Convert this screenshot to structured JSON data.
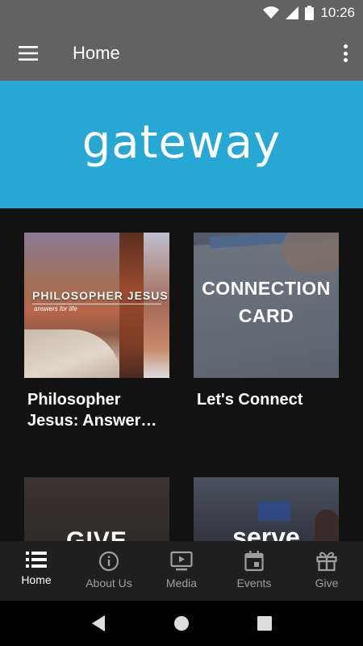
{
  "status_bar": {
    "time": "10:26"
  },
  "app_bar": {
    "title": "Home"
  },
  "banner": {
    "logo_text": "gateway",
    "background_color": "#27a7d3"
  },
  "cards": [
    {
      "title": "Philosopher Jesus: Answer…",
      "image_text": "PHILOSOPHER JESUS",
      "image_subtext": "answers for life"
    },
    {
      "title": "Let's Connect",
      "image_text_line1": "CONNECTION",
      "image_text_line2": "CARD"
    },
    {
      "title": "",
      "image_text": "GIVE"
    },
    {
      "title": "",
      "image_text": "serve"
    }
  ],
  "bottom_nav": {
    "items": [
      {
        "label": "Home",
        "icon": "list-icon",
        "active": true
      },
      {
        "label": "About Us",
        "icon": "info-icon",
        "active": false
      },
      {
        "label": "Media",
        "icon": "media-icon",
        "active": false
      },
      {
        "label": "Events",
        "icon": "calendar-icon",
        "active": false
      },
      {
        "label": "Give",
        "icon": "gift-icon",
        "active": false
      }
    ]
  },
  "system_nav": {
    "buttons": [
      "back",
      "home",
      "recents"
    ]
  },
  "colors": {
    "app_bar": "#626262",
    "background": "#121212",
    "nav_bar": "#1f1f1f",
    "inactive": "#9e9e9e"
  }
}
